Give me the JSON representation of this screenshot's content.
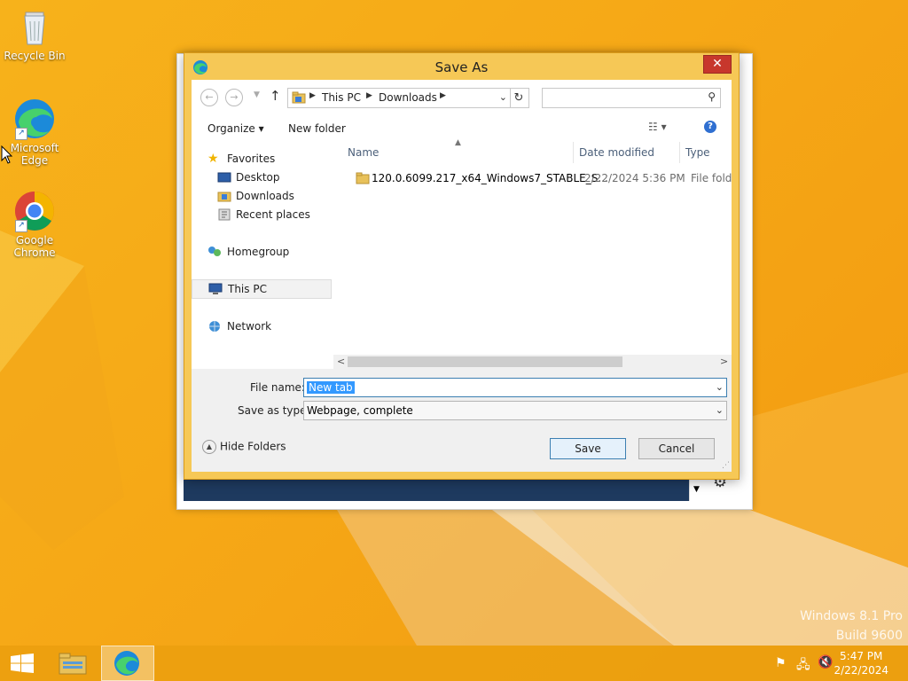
{
  "desktop": {
    "icons": [
      {
        "label": "Recycle Bin"
      },
      {
        "label": "Microsoft Edge"
      },
      {
        "label": "Google Chrome"
      }
    ],
    "watermark": {
      "line1": "Windows 8.1 Pro",
      "line2": "Build 9600"
    }
  },
  "dialog": {
    "title": "Save As",
    "close": "✕",
    "breadcrumb": [
      "This PC",
      "Downloads"
    ],
    "search_placeholder": "",
    "toolbar": {
      "organize": "Organize ▾",
      "new_folder": "New folder"
    },
    "nav": {
      "favorites": "Favorites",
      "desktop": "Desktop",
      "downloads": "Downloads",
      "recent": "Recent places",
      "homegroup": "Homegroup",
      "thispc": "This PC",
      "network": "Network"
    },
    "columns": {
      "name": "Name",
      "date": "Date modified",
      "type": "Type"
    },
    "files": [
      {
        "name": "120.0.6099.217_x64_Windows7_STABLE_S...",
        "date": "2/22/2024 5:36 PM",
        "type": "File folder"
      }
    ],
    "file_name_label": "File name:",
    "file_name_value": "New tab",
    "save_type_label": "Save as type:",
    "save_type_value": "Webpage, complete",
    "save_button": "Save",
    "cancel_button": "Cancel",
    "hide_folders": "Hide Folders"
  },
  "taskbar": {
    "time": "5:47 PM",
    "date": "2/22/2024"
  }
}
